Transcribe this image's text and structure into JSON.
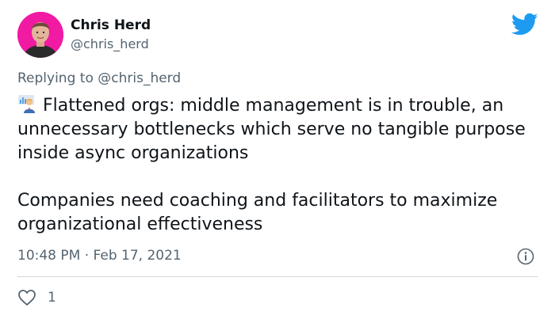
{
  "author": {
    "name": "Chris Herd",
    "handle": "@chris_herd",
    "avatar_bg": "#f01aa3",
    "avatar_icon": "person-photo"
  },
  "reply": {
    "prefix": "Replying to ",
    "mention": "@chris_herd"
  },
  "tweet": {
    "emoji_icon": "office-worker-emoji",
    "paragraphs": [
      "Flattened orgs: middle management is in trouble, an unnecessary bottlenecks which serve no tangible purpose inside async organizations",
      "Companies need coaching and facilitators to maximize organizational effectiveness"
    ]
  },
  "meta": {
    "time": "10:48 PM",
    "separator": " · ",
    "date": "Feb 17, 2021"
  },
  "actions": {
    "like_icon": "heart-icon",
    "like_count": "1",
    "info_icon": "info-icon"
  },
  "brand": {
    "logo": "twitter-bird-icon",
    "color": "#1d9bf0",
    "text_secondary": "#536471",
    "text_primary": "#0f1419",
    "divider": "#cfd9de"
  }
}
